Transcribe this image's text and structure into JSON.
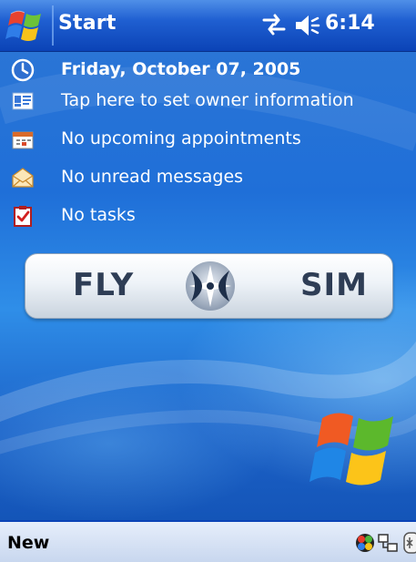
{
  "titlebar": {
    "title": "Start",
    "clock": "6:14",
    "icons": [
      "windows-flag-icon",
      "connectivity-icon",
      "volume-icon"
    ]
  },
  "today": {
    "items": [
      {
        "icon": "clock-icon",
        "label": "Friday, October 07, 2005"
      },
      {
        "icon": "owner-card-icon",
        "label": "Tap here to set owner information"
      },
      {
        "icon": "calendar-icon",
        "label": "No upcoming appointments"
      },
      {
        "icon": "envelope-icon",
        "label": "No unread messages"
      },
      {
        "icon": "task-clipboard-icon",
        "label": "No tasks"
      }
    ]
  },
  "banner": {
    "left_text": "FLY",
    "right_text": "SIM"
  },
  "menubar": {
    "new_label": "New",
    "tray_icons": [
      "color-ball-icon",
      "sync-icon",
      "partial-icon"
    ]
  },
  "colors": {
    "titlebar": "#1f5fd1",
    "desktop": "#2a75d6",
    "menubar": "#d6e2f4",
    "banner_text": "#2e3d55"
  }
}
